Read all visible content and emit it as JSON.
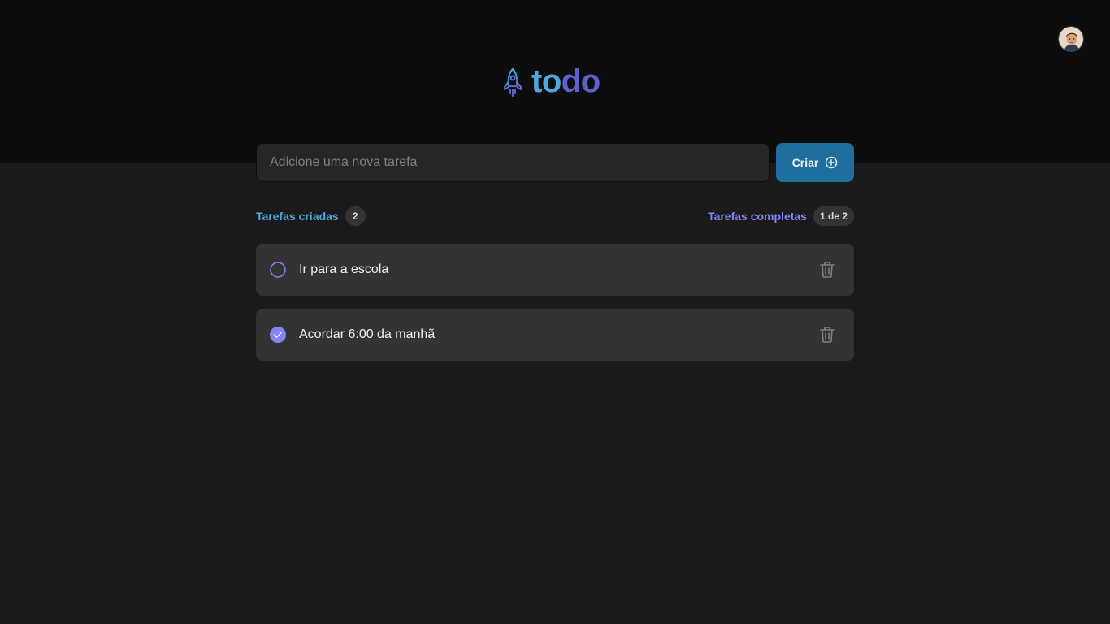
{
  "header": {
    "logo_text_part1": "to",
    "logo_text_part2": "do",
    "avatar_icon": "user-avatar"
  },
  "new_task": {
    "placeholder": "Adicione uma nova tarefa",
    "value": "",
    "create_label": "Criar",
    "create_icon": "plus-circle-icon"
  },
  "summary": {
    "created_label": "Tarefas criadas",
    "created_count": "2",
    "completed_label": "Tarefas completas",
    "completed_count": "1 de 2"
  },
  "tasks": [
    {
      "text": "Ir para a escola",
      "done": false
    },
    {
      "text": "Acordar 6:00 da manhã",
      "done": true
    }
  ],
  "colors": {
    "header_bg": "#0d0d0d",
    "page_bg": "#1a1a1a",
    "blue": "#4ea8de",
    "blue_dark": "#1e6f9f",
    "purple": "#8284fa",
    "purple_dark": "#5e60ce",
    "card_bg": "#333333",
    "input_bg": "#262626"
  }
}
